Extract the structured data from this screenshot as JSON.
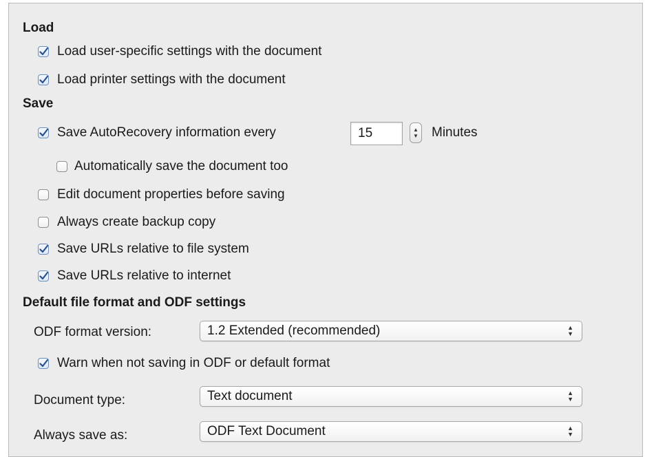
{
  "load": {
    "title": "Load",
    "user_settings": {
      "label": "Load user-specific settings with the document",
      "checked": true
    },
    "printer_settings": {
      "label": "Load printer settings with the document",
      "checked": true
    }
  },
  "save": {
    "title": "Save",
    "autorecovery": {
      "label": "Save AutoRecovery information every",
      "checked": true,
      "value": "15",
      "unit": "Minutes"
    },
    "autosave": {
      "label": "Automatically save the document too",
      "checked": false
    },
    "edit_props": {
      "label": "Edit document properties before saving",
      "checked": false
    },
    "backup": {
      "label": "Always create backup copy",
      "checked": false
    },
    "urls_fs": {
      "label": "Save URLs relative to file system",
      "checked": true
    },
    "urls_inet": {
      "label": "Save URLs relative to internet",
      "checked": true
    }
  },
  "format": {
    "title": "Default file format and ODF settings",
    "odf_version": {
      "label": "ODF format version:",
      "value": "1.2 Extended (recommended)"
    },
    "warn": {
      "label": "Warn when not saving in ODF or default format",
      "checked": true
    },
    "doc_type": {
      "label": "Document type:",
      "value": "Text document"
    },
    "save_as": {
      "label": "Always save as:",
      "value": "ODF Text Document"
    }
  },
  "colors": {
    "panel_bg": "#ececec",
    "check_accent": "#2a4f8a"
  },
  "icons": {
    "check": "checkmark-icon",
    "stepper": "up-down-arrows-icon",
    "select": "chevron-up-down-icon"
  }
}
